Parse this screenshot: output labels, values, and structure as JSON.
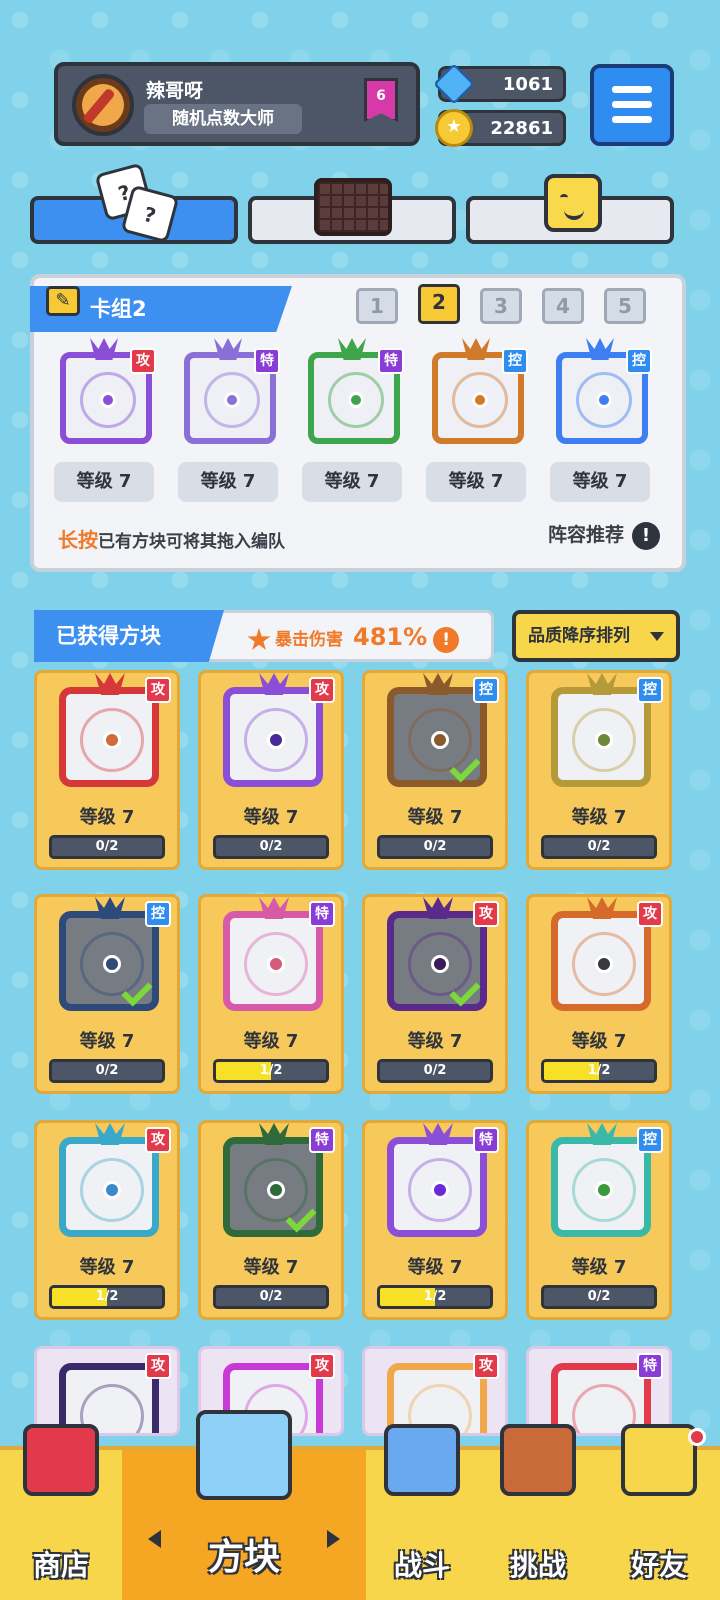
{
  "profile": {
    "name": "辣哥呀",
    "title": "随机点数大师",
    "rank": "6"
  },
  "resources": {
    "gems": "1061",
    "coins": "22861"
  },
  "deck": {
    "title": "卡组2",
    "numbers": [
      "1",
      "2",
      "3",
      "4",
      "5"
    ],
    "active_index": 1,
    "slots": [
      {
        "tag": "攻",
        "level": "等级 7",
        "color": "#8a4fd6"
      },
      {
        "tag": "特",
        "level": "等级 7",
        "color": "#8a6fd6"
      },
      {
        "tag": "特",
        "level": "等级 7",
        "color": "#3ea54a"
      },
      {
        "tag": "控",
        "level": "等级 7",
        "color": "#d07a2a"
      },
      {
        "tag": "控",
        "level": "等级 7",
        "color": "#3d7ff0"
      }
    ],
    "hint_highlight": "长按",
    "hint_text": "已有方块可将其拖入编队",
    "recommend": "阵容推荐",
    "recommend_icon": "!"
  },
  "owned": {
    "title": "已获得方块",
    "crit_label": "暴击伤害",
    "crit_value": "481%",
    "crit_icon": "!",
    "sort_label": "品质降序排列"
  },
  "cards": [
    {
      "tag": "攻",
      "level": "等级 7",
      "progress": "0/2",
      "fill": 0,
      "color": "#d6383a",
      "dot": "#d06a3a",
      "dark": false,
      "check": false
    },
    {
      "tag": "攻",
      "level": "等级 7",
      "progress": "0/2",
      "fill": 0,
      "color": "#8a4fd6",
      "dot": "#4a2a9a",
      "dark": false,
      "check": false
    },
    {
      "tag": "控",
      "level": "等级 7",
      "progress": "0/2",
      "fill": 0,
      "color": "#8a5a2a",
      "dot": "#8a5a2a",
      "dark": true,
      "check": true
    },
    {
      "tag": "控",
      "level": "等级 7",
      "progress": "0/2",
      "fill": 0,
      "color": "#b59a3a",
      "dot": "#6a8a3a",
      "dark": false,
      "check": false
    },
    {
      "tag": "控",
      "level": "等级 7",
      "progress": "0/2",
      "fill": 0,
      "color": "#2e4a7a",
      "dot": "#2e4a7a",
      "dark": true,
      "check": true
    },
    {
      "tag": "特",
      "level": "等级 7",
      "progress": "1/2",
      "fill": 0.5,
      "color": "#d65aa8",
      "dot": "#d65a7a",
      "dark": false,
      "check": false
    },
    {
      "tag": "攻",
      "level": "等级 7",
      "progress": "0/2",
      "fill": 0,
      "color": "#5a2a8a",
      "dot": "#3a1a5a",
      "dark": true,
      "check": true
    },
    {
      "tag": "攻",
      "level": "等级 7",
      "progress": "1/2",
      "fill": 0.5,
      "color": "#d66a2a",
      "dot": "#3a3a3a",
      "dark": false,
      "check": false
    },
    {
      "tag": "攻",
      "level": "等级 7",
      "progress": "1/2",
      "fill": 0.5,
      "color": "#3aa8c8",
      "dot": "#3a8ac8",
      "dark": false,
      "check": false
    },
    {
      "tag": "特",
      "level": "等级 7",
      "progress": "0/2",
      "fill": 0,
      "color": "#2e6a3a",
      "dot": "#2e6a3a",
      "dark": true,
      "check": true
    },
    {
      "tag": "特",
      "level": "等级 7",
      "progress": "1/2",
      "fill": 0.5,
      "color": "#8a4fd6",
      "dot": "#6a2ad6",
      "dark": false,
      "check": false
    },
    {
      "tag": "控",
      "level": "等级 7",
      "progress": "0/2",
      "fill": 0,
      "color": "#3ab8a8",
      "dot": "#3a9a3a",
      "dark": false,
      "check": false
    }
  ],
  "partial_cards": [
    {
      "tag": "攻",
      "color": "#3a2a6a"
    },
    {
      "tag": "攻",
      "color": "#c83ad6"
    },
    {
      "tag": "攻",
      "color": "#f0a84b"
    },
    {
      "tag": "特",
      "color": "#e2394b"
    }
  ],
  "nav": [
    {
      "label": "商店",
      "icon": "shop-icon",
      "color": "#e2394b"
    },
    {
      "label": "方块",
      "icon": "dice-box-icon",
      "color": "#8fd0f8"
    },
    {
      "label": "战斗",
      "icon": "battle-icon",
      "color": "#6aa8f0"
    },
    {
      "label": "挑战",
      "icon": "challenge-icon",
      "color": "#c86a3a"
    },
    {
      "label": "好友",
      "icon": "friends-icon",
      "color": "#f7d64b"
    }
  ]
}
